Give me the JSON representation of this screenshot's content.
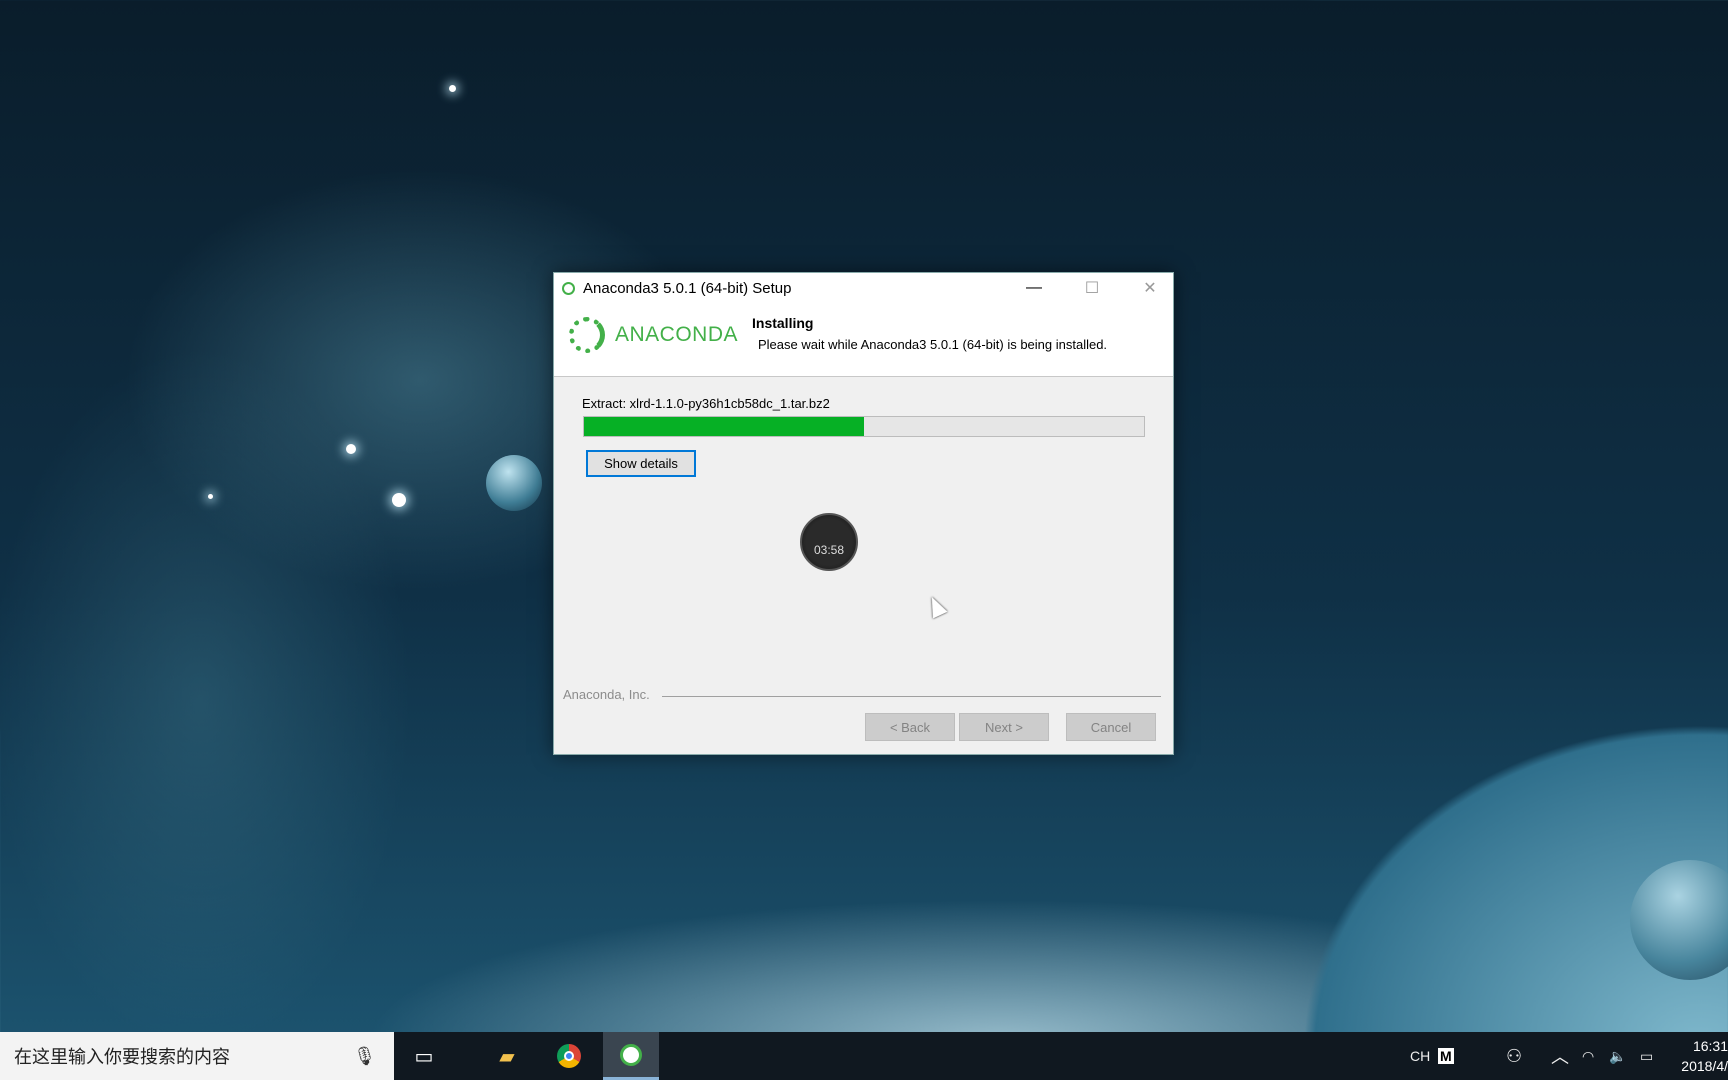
{
  "dialog": {
    "title": "Anaconda3 5.0.1 (64-bit) Setup",
    "brand": "ANACONDA",
    "heading": "Installing",
    "subheading": "Please wait while Anaconda3 5.0.1 (64-bit) is being installed.",
    "status": "Extract: xlrd-1.1.0-py36h1cb58dc_1.tar.bz2",
    "progress_percent": 50,
    "show_details": "Show details",
    "timer": "03:58",
    "footer": "Anaconda, Inc.",
    "back": "< Back",
    "next": "Next >",
    "cancel": "Cancel",
    "minimize": "—",
    "maximize": "☐",
    "close": "✕"
  },
  "taskbar": {
    "search_placeholder": "在这里输入你要搜索的内容",
    "ime": "CH",
    "ime_mode": "M",
    "time": "16:31",
    "date": "2018/4/"
  },
  "colors": {
    "accent": "#43b049",
    "progress": "#06b025",
    "focus": "#0078d7"
  }
}
